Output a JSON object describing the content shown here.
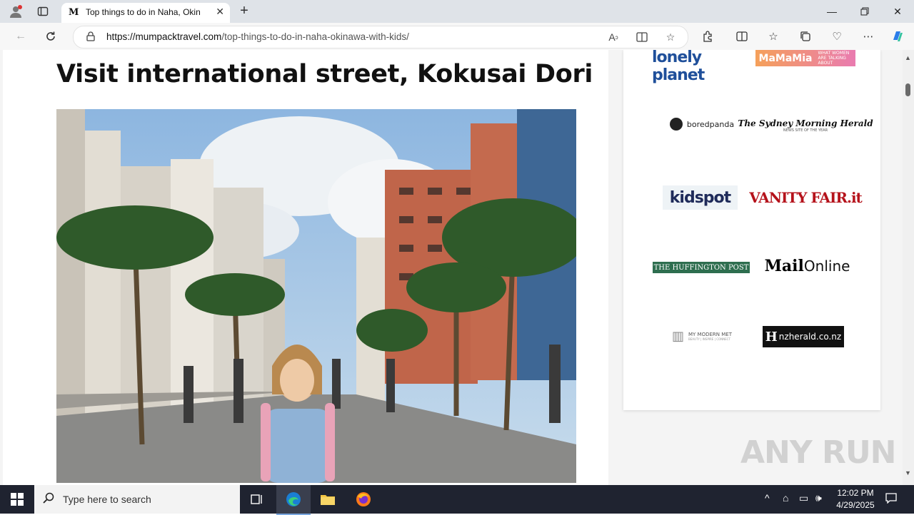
{
  "browser": {
    "tab_title": "Top things to do in Naha, Okinawa with kids",
    "tab_favicon": "M",
    "url_domain": "https://mumpacktravel.com",
    "url_path": "/top-things-to-do-in-naha-okinawa-with-kids/"
  },
  "article": {
    "heading": "Visit international street, Kokusai Dori"
  },
  "sidebar": {
    "logos": [
      {
        "name": "lonely planet"
      },
      {
        "name": "MaMaMia",
        "tagline": "WHAT WOMEN ARE TALKING ABOUT"
      },
      {
        "name": "boredpanda"
      },
      {
        "name": "The Sydney Morning Herald",
        "tagline": "NEWS SITE OF THE YEAR"
      },
      {
        "name": "kidspot"
      },
      {
        "name": "VANITY FAIR.it"
      },
      {
        "name": "THE HUFFINGTON POST"
      },
      {
        "name_bold": "Mail",
        "name_light": "Online"
      },
      {
        "name": "MY MODERN MET",
        "tagline": "BEAUTY | INSPIRE | CONNECT"
      },
      {
        "name": "nzherald.co.nz",
        "mark": "H"
      }
    ]
  },
  "watermark": "ANY RUN",
  "taskbar": {
    "search_placeholder": "Type here to search",
    "time": "12:02 PM",
    "date": "4/29/2025"
  },
  "colors": {
    "edge_blue": "#1a7fd4",
    "taskbar_bg": "#1f2330",
    "kidspot_teal": "#27b3b3",
    "vanity_red": "#b5121b",
    "huffpost_green": "#2e6e4f"
  }
}
